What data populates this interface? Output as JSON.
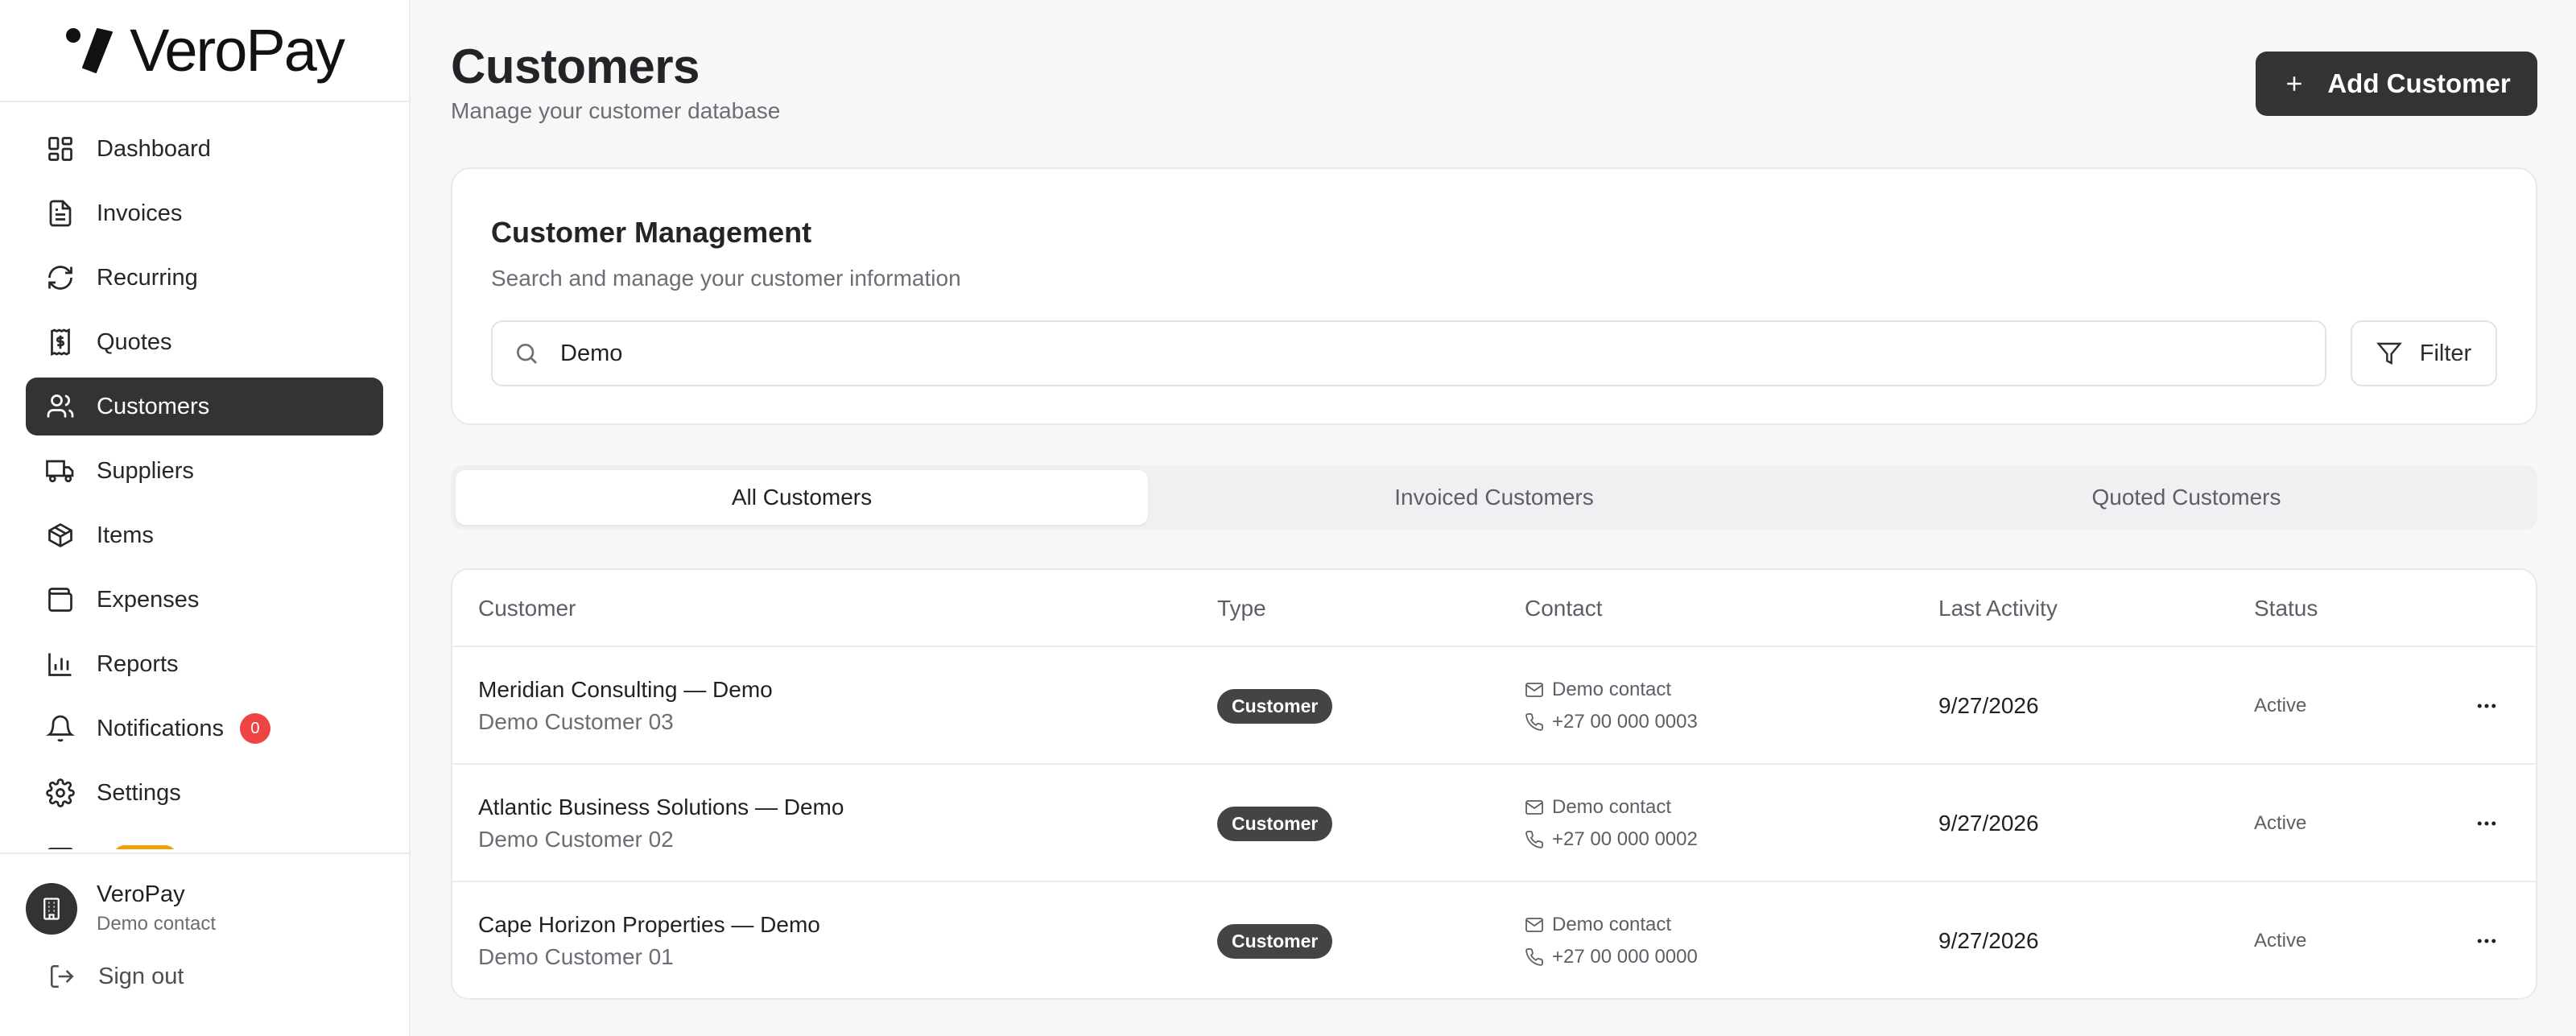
{
  "app": {
    "name": "VeroPay"
  },
  "sidebar": {
    "items": [
      {
        "label": "Dashboard",
        "icon": "dashboard-icon"
      },
      {
        "label": "Invoices",
        "icon": "file-icon"
      },
      {
        "label": "Recurring",
        "icon": "refresh-icon"
      },
      {
        "label": "Quotes",
        "icon": "receipt-icon"
      },
      {
        "label": "Customers",
        "icon": "users-icon",
        "active": true
      },
      {
        "label": "Suppliers",
        "icon": "truck-icon"
      },
      {
        "label": "Items",
        "icon": "box-icon"
      },
      {
        "label": "Expenses",
        "icon": "wallet-icon"
      },
      {
        "label": "Reports",
        "icon": "bar-chart-icon"
      },
      {
        "label": "Notifications",
        "icon": "bell-icon",
        "badge": "0"
      },
      {
        "label": "Settings",
        "icon": "gear-icon"
      }
    ],
    "account": {
      "name": "VeroPay",
      "contact": "Demo contact"
    },
    "signout_label": "Sign out"
  },
  "header": {
    "title": "Customers",
    "subtitle": "Manage your customer database",
    "add_button_label": "Add Customer"
  },
  "management": {
    "title": "Customer Management",
    "subtitle": "Search and manage your customer information",
    "search_value": "Demo",
    "filter_label": "Filter"
  },
  "tabs": [
    {
      "label": "All Customers",
      "active": true
    },
    {
      "label": "Invoiced Customers"
    },
    {
      "label": "Quoted Customers"
    }
  ],
  "table": {
    "columns": [
      "Customer",
      "Type",
      "Contact",
      "Last Activity",
      "Status"
    ],
    "rows": [
      {
        "name": "Meridian Consulting — Demo",
        "sub": "Demo Customer 03",
        "type": "Customer",
        "contact": "Demo contact",
        "phone": "+27 00 000 0003",
        "last_activity": "9/27/2026",
        "status": "Active"
      },
      {
        "name": "Atlantic Business Solutions — Demo",
        "sub": "Demo Customer 02",
        "type": "Customer",
        "contact": "Demo contact",
        "phone": "+27 00 000 0002",
        "last_activity": "9/27/2026",
        "status": "Active"
      },
      {
        "name": "Cape Horizon Properties — Demo",
        "sub": "Demo Customer 01",
        "type": "Customer",
        "contact": "Demo contact",
        "phone": "+27 00 000 0000",
        "last_activity": "9/27/2026",
        "status": "Active"
      }
    ]
  },
  "colors": {
    "accent": "#333333",
    "badge_red": "#ef4444",
    "badge_orange": "#f59e0b",
    "background": "#f7f7f8"
  }
}
